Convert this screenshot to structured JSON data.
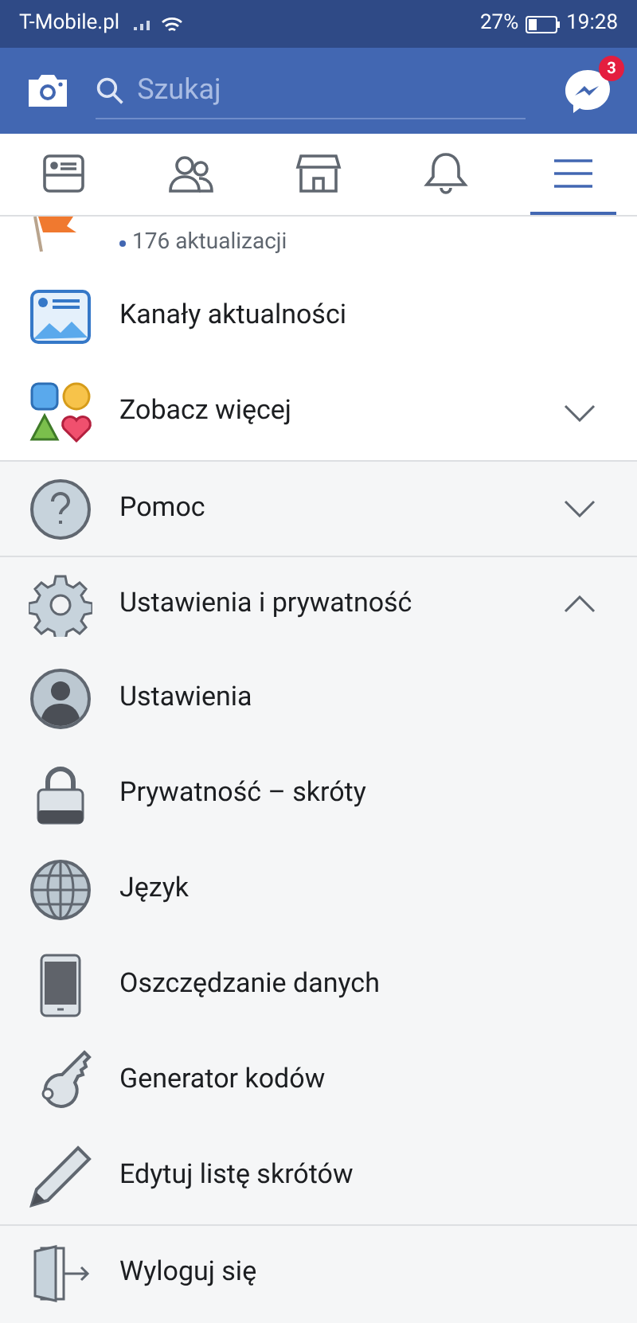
{
  "status_bar": {
    "carrier": "T-Mobile.pl",
    "battery": "27%",
    "time": "19:28"
  },
  "header": {
    "search": {
      "placeholder": "Szukaj"
    },
    "messenger_badge": "3"
  },
  "tabs": [
    {
      "kind": "feed",
      "selected": false
    },
    {
      "kind": "friends",
      "selected": false
    },
    {
      "kind": "market",
      "selected": false
    },
    {
      "kind": "bell",
      "selected": false
    },
    {
      "kind": "menu",
      "selected": true
    }
  ],
  "partial_row": {
    "subtitle": "176 aktualizacji"
  },
  "shortcuts": [
    {
      "kind": "feed",
      "label": "Kanały aktualności"
    },
    {
      "kind": "more",
      "label": "Zobacz więcej",
      "expanded": false
    }
  ],
  "sections": [
    {
      "kind": "help",
      "label": "Pomoc",
      "expanded": false
    },
    {
      "kind": "gear",
      "label": "Ustawienia i prywatność",
      "expanded": true,
      "children": [
        {
          "kind": "person",
          "label": "Ustawienia"
        },
        {
          "kind": "lock",
          "label": "Prywatność – skróty"
        },
        {
          "kind": "globe",
          "label": "Język"
        },
        {
          "kind": "phone",
          "label": "Oszczędzanie danych"
        },
        {
          "kind": "key",
          "label": "Generator kodów"
        },
        {
          "kind": "pencil",
          "label": "Edytuj listę skrótów"
        }
      ]
    }
  ],
  "logout": {
    "kind": "logout",
    "label": "Wyloguj się"
  }
}
